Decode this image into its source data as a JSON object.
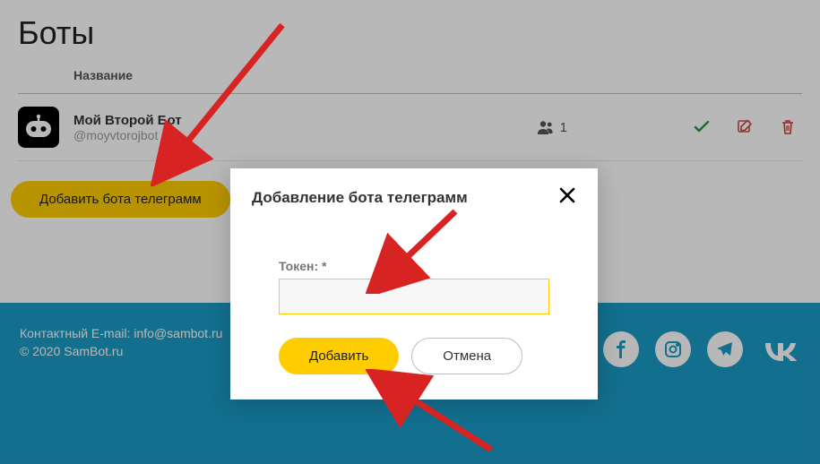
{
  "page": {
    "title": "Боты",
    "column_name": "Название"
  },
  "bot": {
    "name": "Мой Второй Бот",
    "handle": "@moyvtorojbot",
    "user_count": "1"
  },
  "buttons": {
    "add_bot": "Добавить бота телеграмм"
  },
  "modal": {
    "title": "Добавление бота телеграмм",
    "token_label": "Токен: *",
    "token_value": "",
    "add": "Добавить",
    "cancel": "Отмена"
  },
  "footer": {
    "contact_prefix": "Контактный E-mail: ",
    "contact_email": "info@sambot.ru",
    "copyright": "© 2020 SamBot.ru"
  }
}
